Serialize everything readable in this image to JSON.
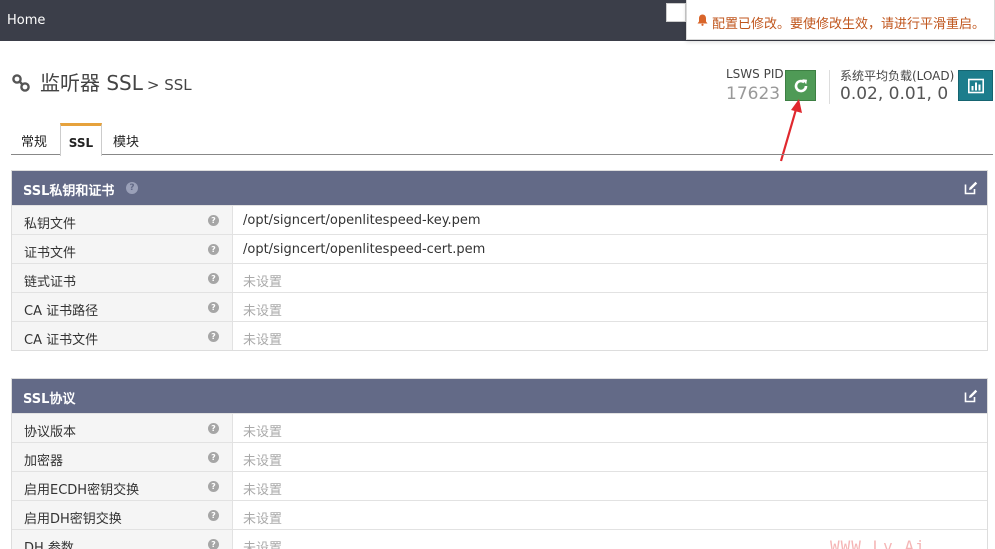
{
  "topbar": {
    "home": "Home"
  },
  "notice": {
    "message": "配置已修改。要使修改生效，请进行平滑重启。"
  },
  "header": {
    "title": "监听器 SSL",
    "subtitle": "> SSL",
    "pid_label": "LSWS PID",
    "pid_value": "17623",
    "load_label": "系统平均负载(LOAD)",
    "load_value": "0.02, 0.01, 0"
  },
  "tabs": [
    {
      "label": "常规"
    },
    {
      "label": "SSL"
    },
    {
      "label": "模块"
    }
  ],
  "panels": [
    {
      "title": "SSL私钥和证书",
      "rows": [
        {
          "label": "私钥文件",
          "value": "/opt/signcert/openlitespeed-key.pem"
        },
        {
          "label": "证书文件",
          "value": "/opt/signcert/openlitespeed-cert.pem"
        },
        {
          "label": "链式证书",
          "value": "未设置"
        },
        {
          "label": "CA 证书路径",
          "value": "未设置"
        },
        {
          "label": "CA 证书文件",
          "value": "未设置"
        }
      ]
    },
    {
      "title": "SSL协议",
      "rows": [
        {
          "label": "协议版本",
          "value": "未设置"
        },
        {
          "label": "加密器",
          "value": "未设置"
        },
        {
          "label": "启用ECDH密钥交换",
          "value": "未设置"
        },
        {
          "label": "启用DH密钥交换",
          "value": "未设置"
        },
        {
          "label": "DH 参数",
          "value": "未设置"
        }
      ]
    }
  ],
  "help_glyph": "?",
  "watermark": "WWW.Lv.Ai",
  "colors": {
    "topbar": "#3b3e49",
    "panel_header": "#636a87",
    "restart_button": "#4f9a56",
    "chart_button": "#1c7d8c",
    "notice_text": "#c0561d",
    "active_tab_accent": "#e6a23c",
    "arrow": "#e0282e"
  }
}
